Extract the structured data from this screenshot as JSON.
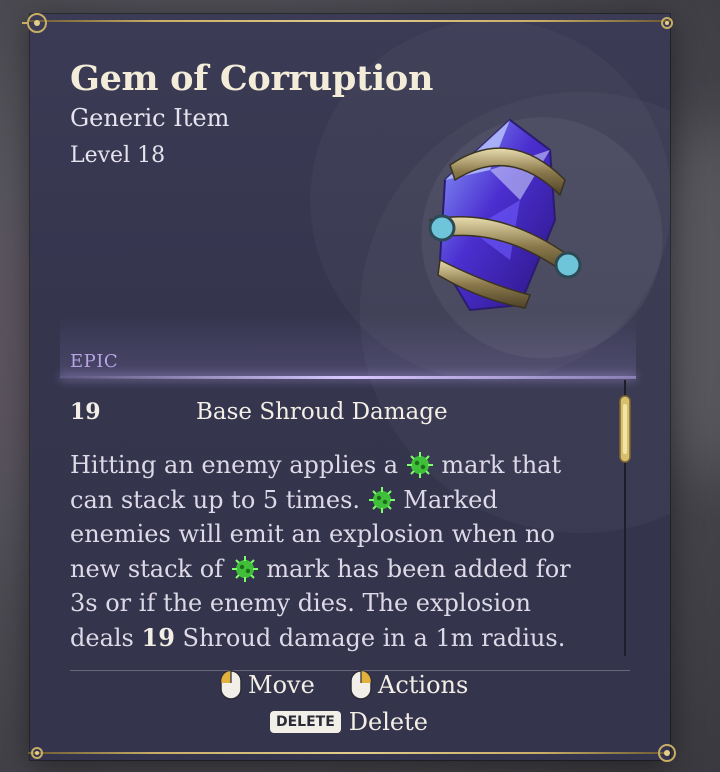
{
  "item": {
    "name": "Gem of Corruption",
    "type": "Generic Item",
    "level": "Level 18",
    "rarity": "EPIC",
    "rarity_color": "#b7a5e6"
  },
  "stat": {
    "value": "19",
    "label": "Base Shroud Damage"
  },
  "description": {
    "line1_a": "Hitting an enemy applies a",
    "line1_b": " mark that",
    "line2_a": "can stack up to 5 times.",
    "line2_b": " Marked",
    "line3": "enemies will emit an explosion when no",
    "line4_a": "new stack of",
    "line4_b": " mark has been added for",
    "line5": "3s or if the enemy dies. The explosion",
    "line6_a": "deals ",
    "line6_num": "19",
    "line6_b": " Shroud damage in a 1m radius.",
    "mark_icon": "green-corruption-mark-icon"
  },
  "controls": {
    "move_label": "Move",
    "actions_label": "Actions",
    "delete_key": "DELETE",
    "delete_label": "Delete"
  },
  "colors": {
    "panel": "#35354e",
    "gold_frame": "#c8ad67",
    "mark_green": "#3fbf3a"
  }
}
